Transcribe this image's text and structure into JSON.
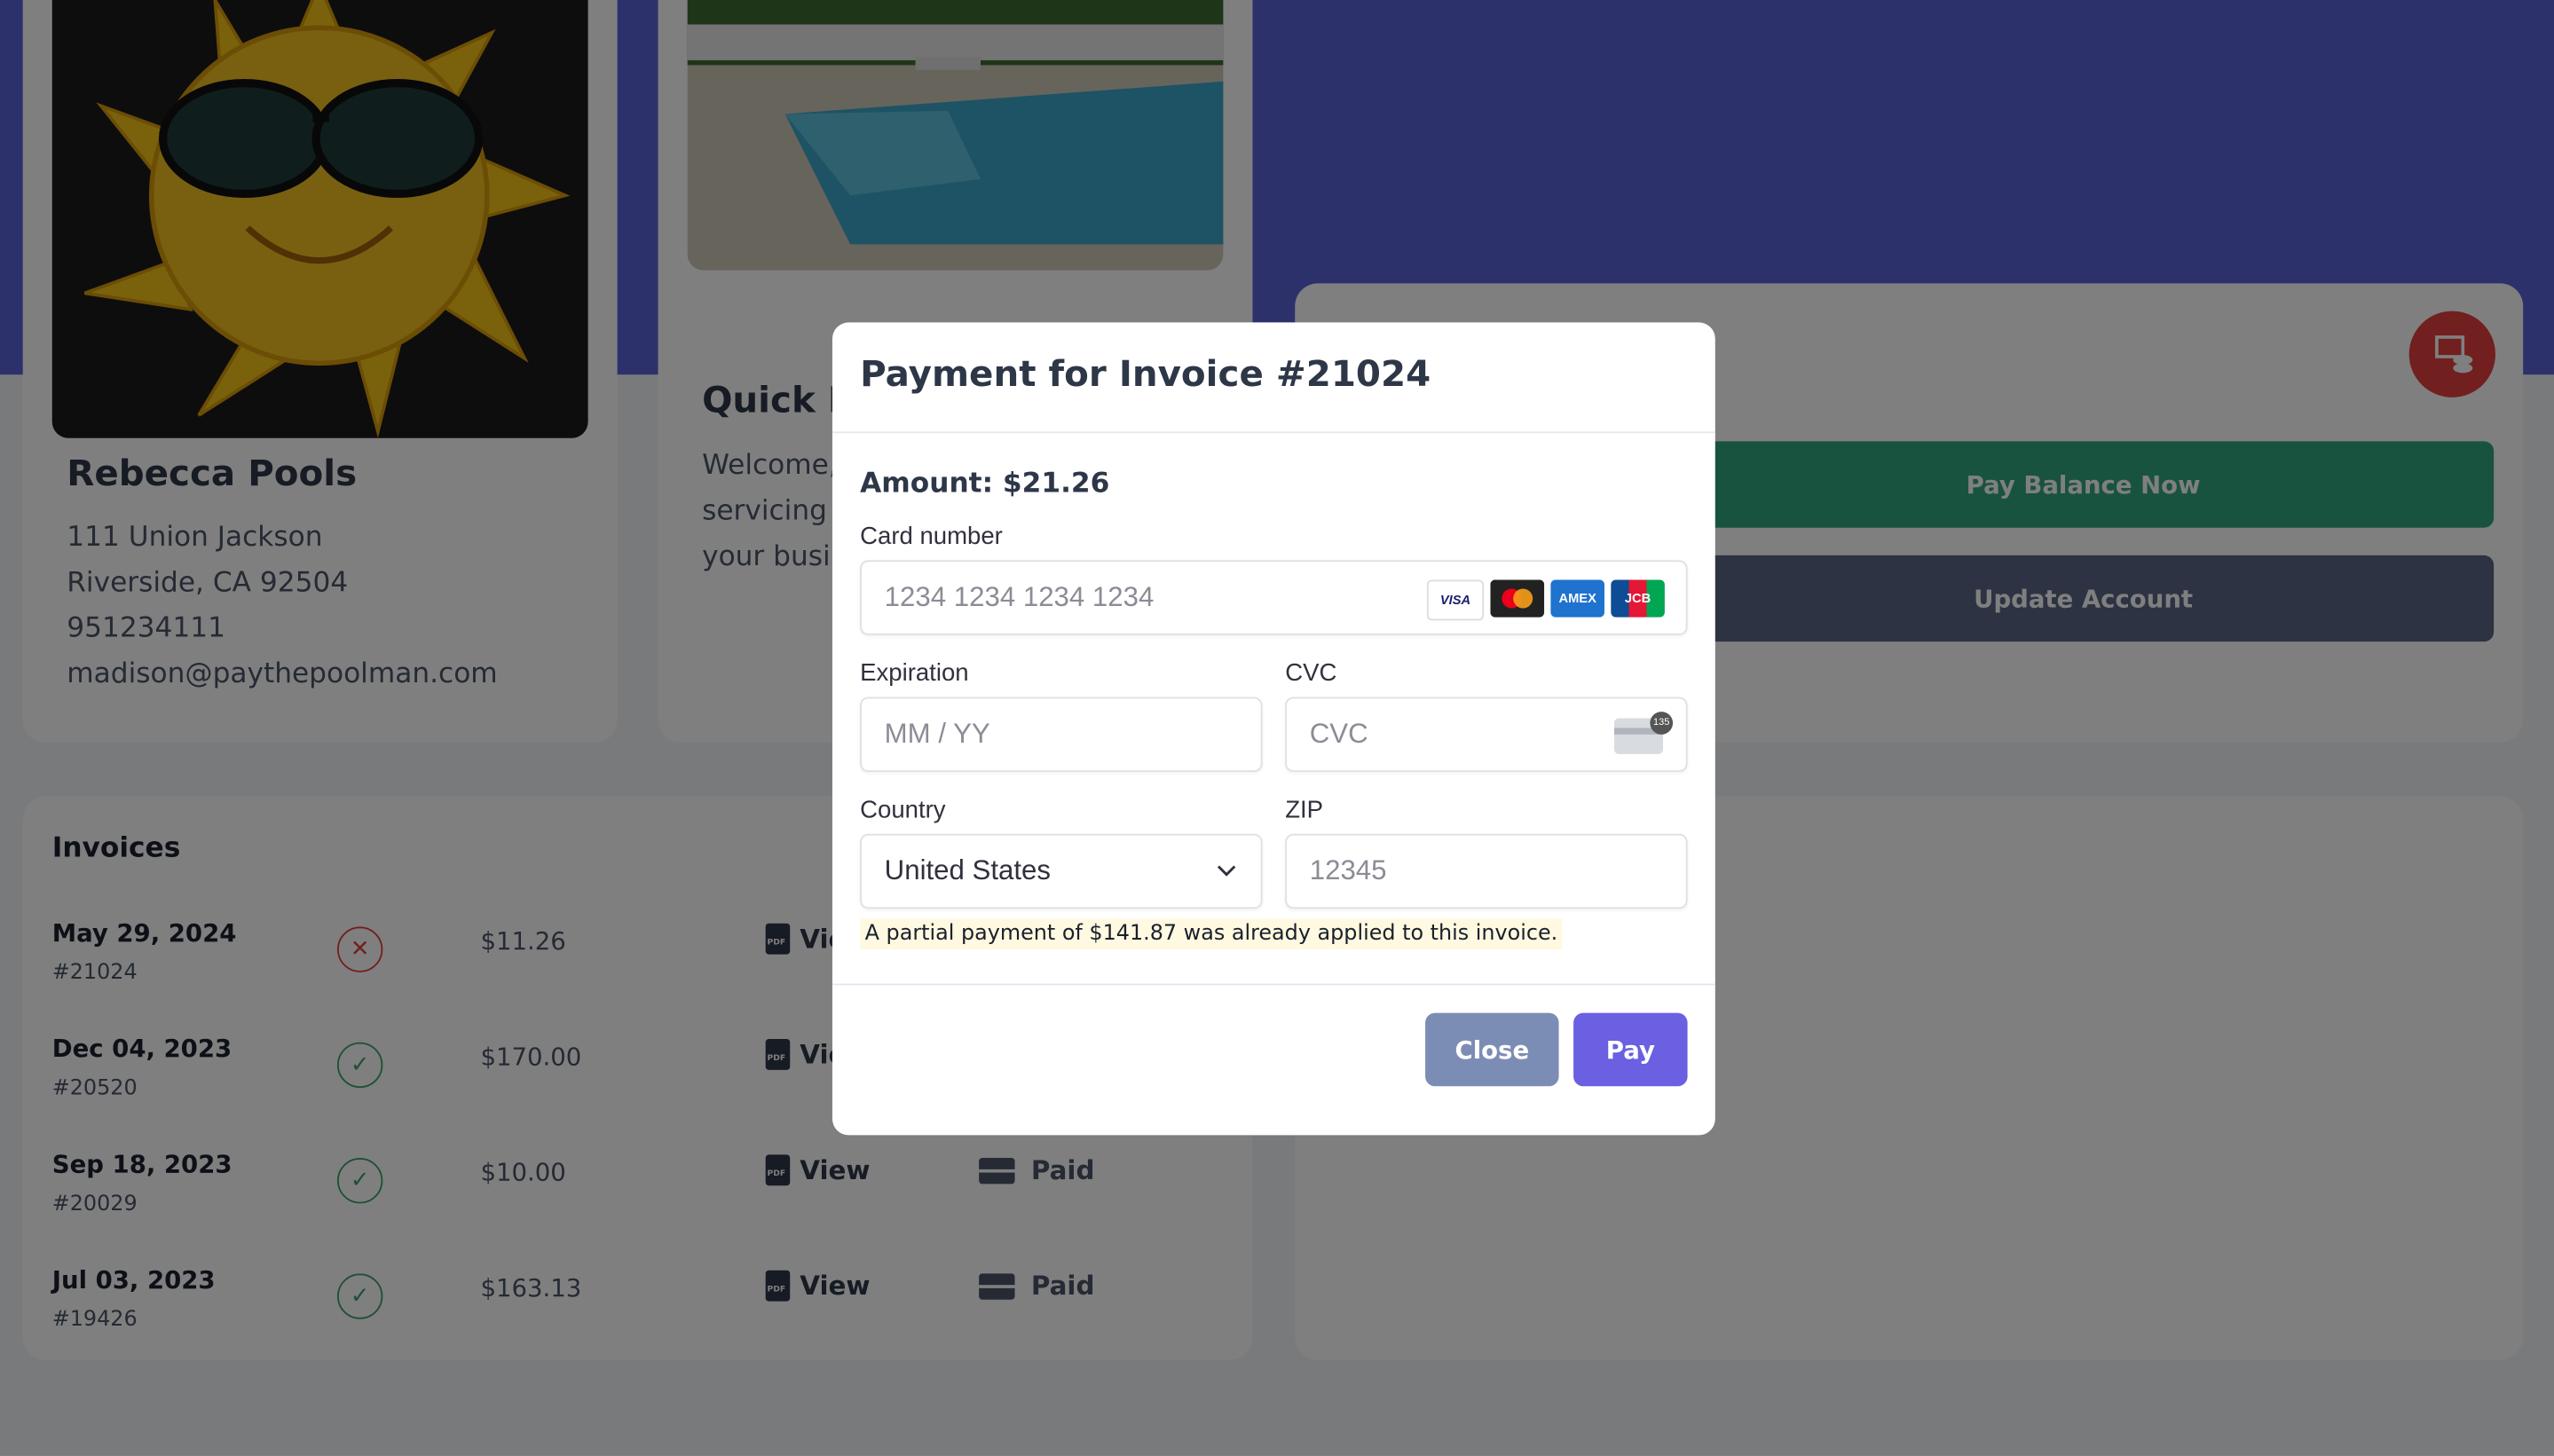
{
  "profile": {
    "name": "Rebecca Pools",
    "address1": "111 Union Jackson",
    "address2": "Riverside, CA 92504",
    "phone": "951234111",
    "email": "madison@paythepoolman.com"
  },
  "welcome": {
    "title": "Quick M",
    "lines": [
      "Welcome,",
      "servicing y",
      "your busi"
    ]
  },
  "actions": {
    "pay_balance_label": "Pay Balance Now",
    "update_account_label": "Update Account",
    "colors": {
      "pay": "#31a77e",
      "update": "#5a6784",
      "round": "#e53e3e"
    }
  },
  "invoices": {
    "title": "Invoices",
    "rows": [
      {
        "date": "May 29, 2024",
        "number": "#21024",
        "status": "unpaid",
        "amount": "$11.26",
        "view": "Vie",
        "paid": ""
      },
      {
        "date": "Dec 04, 2023",
        "number": "#20520",
        "status": "paid",
        "amount": "$170.00",
        "view": "Vie",
        "paid": ""
      },
      {
        "date": "Sep 18, 2023",
        "number": "#20029",
        "status": "paid",
        "amount": "$10.00",
        "view": "View",
        "paid": "Paid"
      },
      {
        "date": "Jul 03, 2023",
        "number": "#19426",
        "status": "paid",
        "amount": "$163.13",
        "view": "View",
        "paid": "Paid"
      }
    ]
  },
  "modal": {
    "title": "Payment for Invoice #21024",
    "amount": "Amount: $21.26",
    "card_number_label": "Card number",
    "card_number_placeholder": "1234 1234 1234 1234",
    "brands": [
      "VISA",
      "MC",
      "AMEX",
      "JCB"
    ],
    "expiration_label": "Expiration",
    "expiration_placeholder": "MM / YY",
    "cvc_label": "CVC",
    "cvc_placeholder": "CVC",
    "cvc_badge": "135",
    "country_label": "Country",
    "country_value": "United States",
    "zip_label": "ZIP",
    "zip_placeholder": "12345",
    "note": "A partial payment of $141.87 was already applied to this invoice.",
    "close_label": "Close",
    "pay_label": "Pay"
  }
}
